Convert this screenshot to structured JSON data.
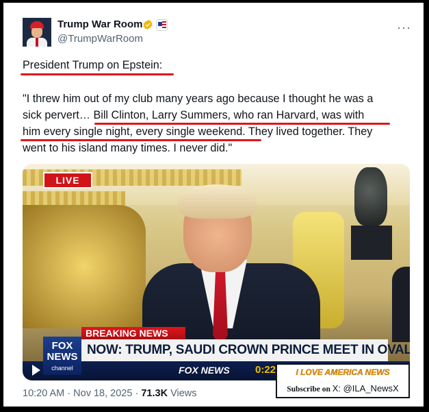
{
  "tweet": {
    "display_name": "Trump War Room",
    "handle": "@TrumpWarRoom",
    "more_label": "···",
    "heading": "President Trump on Epstein:",
    "body_lines": [
      "\"I threw him out of my club many years ago because I thought he was a",
      "sick pervert… Bill Clinton, Larry Summers, who ran Harvard, was with",
      "him every single night, every single weekend. They lived together. They",
      "went to his island many times. I never did.\""
    ]
  },
  "video": {
    "live_badge": "LIVE",
    "breaking_label": "BREAKING NEWS",
    "headline": "NOW: TRUMP, SAUDI CROWN PRINCE MEET IN OVAL OFFICE",
    "network_logo_top": "FOX",
    "network_logo_bottom": "NEWS",
    "network_logo_sub": "channel",
    "ticker_brand": "FOX NEWS",
    "elapsed_time": "0:22",
    "overlay_title": "I LOVE AMERICA NEWS",
    "overlay_subscribe": "Subscribe on",
    "overlay_x": "X: @ILA_NewsX"
  },
  "meta": {
    "time": "10:20 AM",
    "sep": "·",
    "date": "Nov 18, 2025",
    "views_count": "71.3K",
    "views_label": "Views"
  },
  "colors": {
    "underline": "#e0151b",
    "verified_badge": "#f4b400",
    "text_primary": "#0f1419",
    "text_secondary": "#536471"
  },
  "icons": [
    "verified-badge-icon",
    "affiliation-flag-icon",
    "more-options-icon",
    "play-icon"
  ]
}
